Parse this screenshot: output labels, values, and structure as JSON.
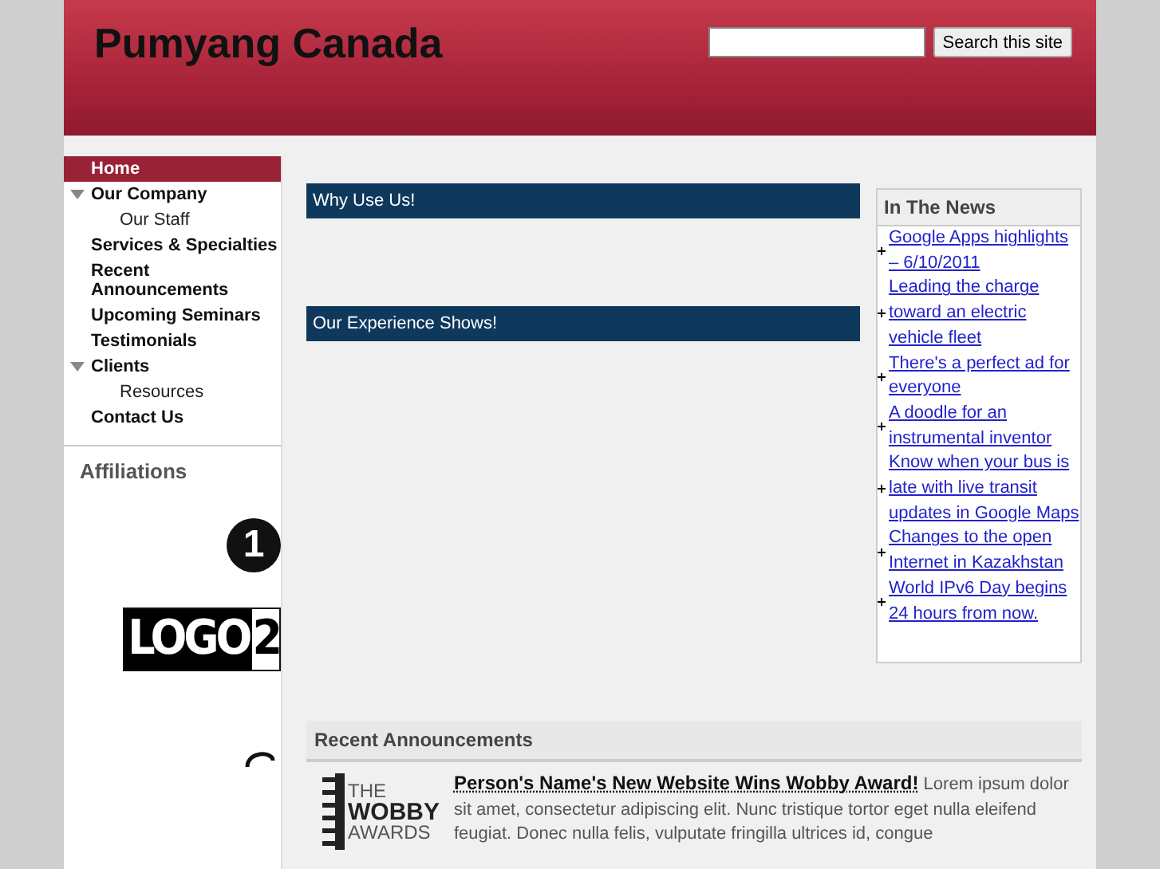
{
  "site_title": "Pumyang Canada",
  "search": {
    "button": "Search this site"
  },
  "nav": [
    {
      "label": "Home",
      "selected": true,
      "expanded": false
    },
    {
      "label": "Our Company",
      "selected": false,
      "expanded": true,
      "children": [
        {
          "label": "Our Staff",
          "selected": false
        }
      ]
    },
    {
      "label": "Services & Specialties",
      "selected": false,
      "expanded": false
    },
    {
      "label": "Recent Announcements",
      "selected": false,
      "expanded": false
    },
    {
      "label": "Upcoming Seminars",
      "selected": false,
      "expanded": false
    },
    {
      "label": "Testimonials",
      "selected": false,
      "expanded": false
    },
    {
      "label": "Clients",
      "selected": false,
      "expanded": true,
      "children": [
        {
          "label": "Resources",
          "selected": false
        }
      ]
    },
    {
      "label": "Contact Us",
      "selected": false,
      "expanded": false
    }
  ],
  "affiliations": {
    "title": "Affiliations",
    "logos": [
      {
        "kind": "circle-number",
        "text": "1"
      },
      {
        "kind": "boxed",
        "text": "LOGO",
        "suffix": "2"
      }
    ]
  },
  "sections": [
    "Why Use Us!",
    "Our Experience Shows!"
  ],
  "news": {
    "title": "In The News",
    "items": [
      "Google Apps highlights – 6/10/2011",
      "Leading the charge toward an electric vehicle fleet",
      "There's a perfect ad for everyone",
      "A doodle for an instrumental inventor",
      "Know when your bus is late with live transit updates in Google Maps",
      "Changes to the open Internet in Kazakhstan",
      "World IPv6 Day begins 24 hours from now."
    ]
  },
  "announcements": {
    "title": "Recent Announcements",
    "items": [
      {
        "logo": [
          "THE",
          "WOBBY",
          "AWARDS"
        ],
        "headline": "Person's Name's New Website Wins Wobby Award!",
        "body": "Lorem ipsum dolor sit amet, consectetur adipiscing elit. Nunc tristique tortor eget nulla eleifend feugiat. Donec nulla felis, vulputate fringilla ultrices id, congue"
      }
    ]
  }
}
